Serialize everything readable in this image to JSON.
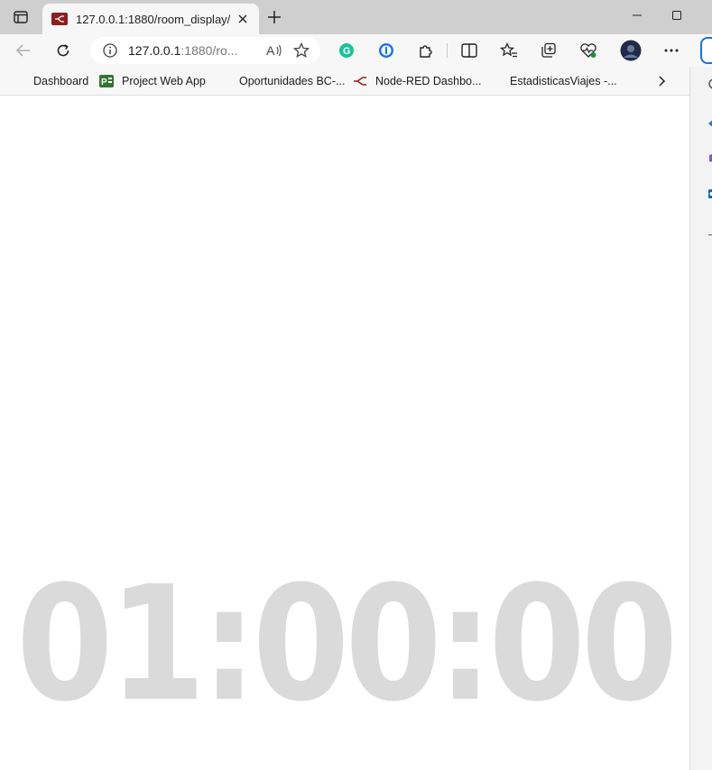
{
  "tab": {
    "title": "127.0.0.1:1880/room_display/"
  },
  "address_bar": {
    "host": "127.0.0.1",
    "rest": ":1880/ro..."
  },
  "bookmarks": [
    {
      "label": "Dashboard",
      "icon": "microsoft-logo-icon"
    },
    {
      "label": "Project Web App",
      "icon": "project-icon"
    },
    {
      "label": "Oportunidades BC-...",
      "icon": "microsoft-logo-icon"
    },
    {
      "label": "Node-RED Dashbo...",
      "icon": "node-red-icon"
    },
    {
      "label": "EstadisticasViajes -...",
      "icon": "microsoft-logo-icon"
    }
  ],
  "display": {
    "time": "01:00:00"
  },
  "colors": {
    "clock": "#dadada",
    "node_red": "#8f1d1d",
    "grammarly": "#15c39a"
  }
}
